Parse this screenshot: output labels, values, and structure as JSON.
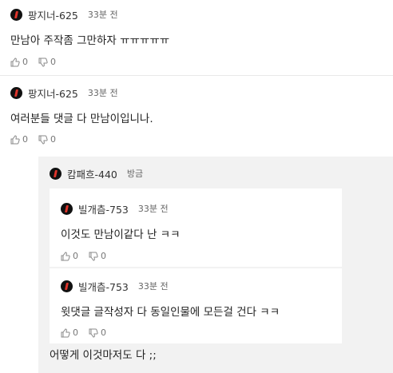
{
  "comments": [
    {
      "author": "팡지너-625",
      "time": "33분 전",
      "text": "만남아 주작좀 그만하자 ㅠㅠㅠㅠㅠ",
      "likes": "0",
      "dislikes": "0"
    },
    {
      "author": "팡지너-625",
      "time": "33분 전",
      "text": "여러분들 댓글 다 만남이입니나.",
      "likes": "0",
      "dislikes": "0"
    }
  ],
  "reply": {
    "author": "캄패흐-440",
    "time": "방금",
    "text": "어떻게 이것마저도 다 ;;"
  },
  "subreplies": [
    {
      "author": "빌개츰-753",
      "time": "33분 전",
      "text": "이것도 만남이같다 난 ㅋㅋ",
      "likes": "0",
      "dislikes": "0"
    },
    {
      "author": "빌개츰-753",
      "time": "33분 전",
      "text": "윗댓글 글작성자 다 동일인물에 모든걸 건다 ㅋㅋ",
      "likes": "0",
      "dislikes": "0"
    }
  ]
}
